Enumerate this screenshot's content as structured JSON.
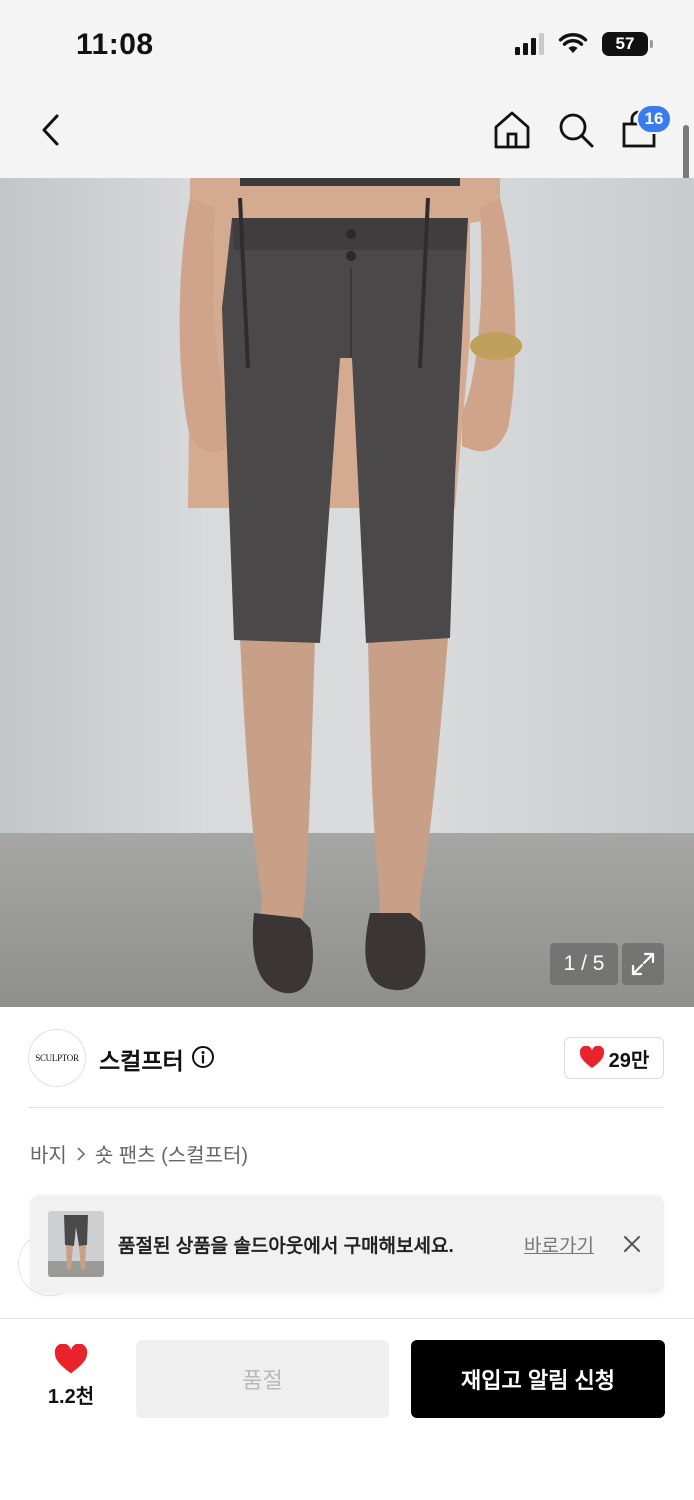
{
  "status_bar": {
    "time": "11:08",
    "battery": "57",
    "icons": [
      "cellular-signal-icon",
      "wifi-icon",
      "battery-icon"
    ]
  },
  "nav": {
    "icons": [
      "back-arrow-icon",
      "home-icon",
      "search-icon",
      "shopping-bag-icon"
    ],
    "bag_count": "16"
  },
  "gallery": {
    "counter": "1 / 5",
    "expand_icon": "expand-icon"
  },
  "brand": {
    "logo_text": "SCULPTOR",
    "name": "스컬프터",
    "likes": "29만",
    "heart_color": "#e8232b"
  },
  "breadcrumb": {
    "category": "바지",
    "subcategory": "숏 팬츠 (스컬프터)"
  },
  "toast": {
    "message": "품절된 상품을 솔드아웃에서 구매해보세요.",
    "link": "바로가기"
  },
  "bottom_bar": {
    "wish_count": "1.2천",
    "soldout_label": "품절",
    "restock_label": "재입고 알림 신청"
  }
}
